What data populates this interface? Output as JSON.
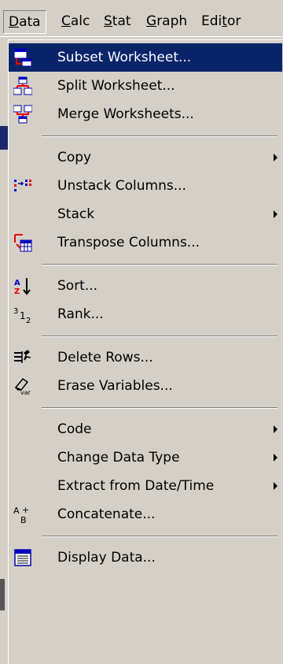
{
  "menubar": {
    "data": "Data",
    "calc": "Calc",
    "stat": "Stat",
    "graph": "Graph",
    "editor": "Editor"
  },
  "menu": {
    "subset_worksheet": "Subset Worksheet...",
    "split_worksheet": "Split Worksheet...",
    "merge_worksheets": "Merge Worksheets...",
    "copy": "Copy",
    "unstack_columns": "Unstack Columns...",
    "stack": "Stack",
    "transpose_columns": "Transpose Columns...",
    "sort": "Sort...",
    "rank": "Rank...",
    "delete_rows": "Delete Rows...",
    "erase_variables": "Erase Variables...",
    "code": "Code",
    "change_data_type": "Change Data Type",
    "extract_from_date_time": "Extract from Date/Time",
    "concatenate": "Concatenate...",
    "display_data": "Display Data..."
  },
  "colors": {
    "menu_bg": "#d4d0c8",
    "highlight_bg": "#0a246a",
    "highlight_text": "#ffffff"
  }
}
